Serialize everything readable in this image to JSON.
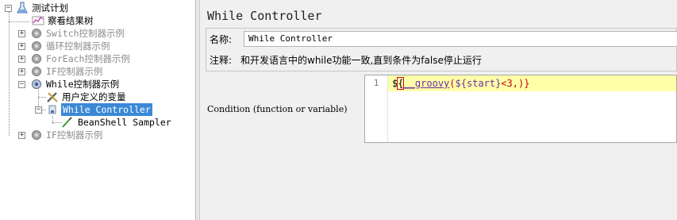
{
  "tree": {
    "root": "测试计划",
    "items": [
      {
        "label": "察看结果树"
      },
      {
        "label": "Switch控制器示例"
      },
      {
        "label": "循环控制器示例"
      },
      {
        "label": "ForEach控制器示例"
      },
      {
        "label": "IF控制器示例"
      },
      {
        "label": "While控制器示例"
      },
      {
        "label": "用户定义的变量"
      },
      {
        "label": "While Controller"
      },
      {
        "label": "BeanShell Sampler"
      },
      {
        "label": "IF控制器示例"
      }
    ],
    "toggle_plus": "+",
    "toggle_minus": "−"
  },
  "panel": {
    "title": "While Controller",
    "name_label": "名称:",
    "name_value": "While Controller",
    "comment_label": "注释:",
    "comment_value": "和开发语言中的while功能一致,直到条件为false停止运行",
    "condition_label": "Condition (function or variable)"
  },
  "editor": {
    "line_number": "1",
    "code": {
      "dollar": "$",
      "open": "{",
      "fn": "__groovy",
      "paren_open": "(",
      "var": "${start}",
      "rest": "<3,",
      "close": ")}"
    }
  },
  "colors": {
    "selection": "#3b89d6",
    "highlight_line": "#ffffaa"
  },
  "icons": {
    "plan": "test-plan-icon",
    "listener": "listener-icon",
    "controller": "gear-icon",
    "config": "wrench-icon",
    "sampler": "pipette-icon"
  }
}
